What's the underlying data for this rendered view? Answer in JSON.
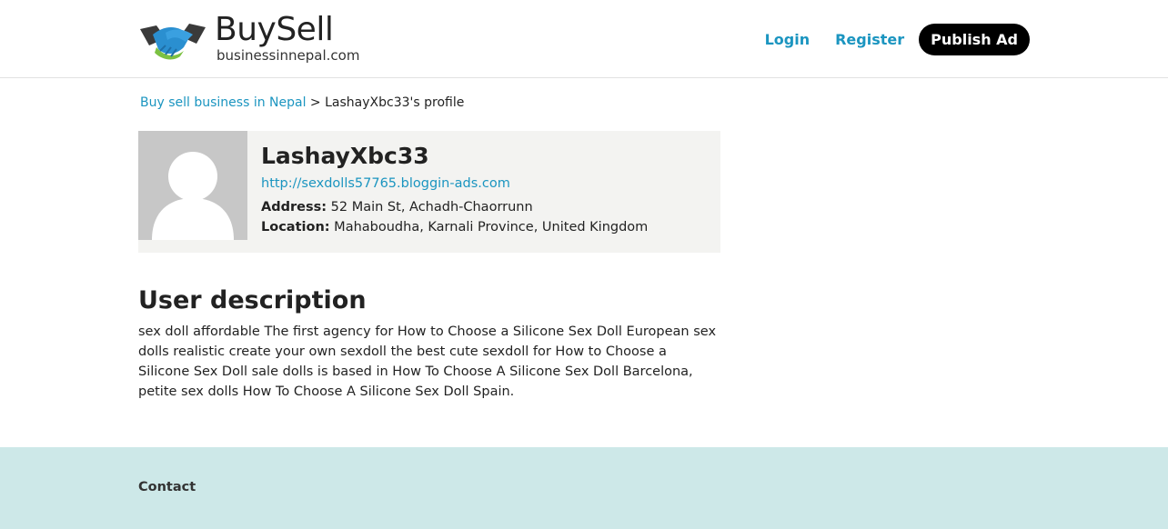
{
  "header": {
    "logo": {
      "title": "BuySell",
      "subtitle": "businessinnepal.com"
    },
    "nav": {
      "login": "Login",
      "register": "Register",
      "publish": "Publish Ad"
    }
  },
  "breadcrumb": {
    "home": "Buy sell business in Nepal",
    "separator": " > ",
    "current": "LashayXbc33's profile"
  },
  "profile": {
    "username": "LashayXbc33",
    "website": "http://sexdolls57765.bloggin-ads.com",
    "address_label": "Address:",
    "address": " 52 Main St, Achadh-Chaorrunn",
    "location_label": "Location:",
    "location": " Mahaboudha, Karnali Province, United Kingdom"
  },
  "description": {
    "title": "User description",
    "text": "sex doll affordable The first agency for How to Choose a Silicone Sex Doll European sex dolls realistic create your own sexdoll the best cute sexdoll for How to Choose a Silicone Sex Doll sale dolls is based in How To Choose A Silicone Sex Doll Barcelona, petite sex dolls How To Choose A Silicone Sex Doll Spain."
  },
  "footer": {
    "contact": "Contact"
  },
  "colors": {
    "link": "#1b95c0",
    "publish_bg": "#000000",
    "card_bg": "#f3f3f1",
    "footer_bg": "#cde8e8"
  },
  "icons": {
    "logo": "handshake-icon",
    "avatar": "default-user-icon"
  }
}
